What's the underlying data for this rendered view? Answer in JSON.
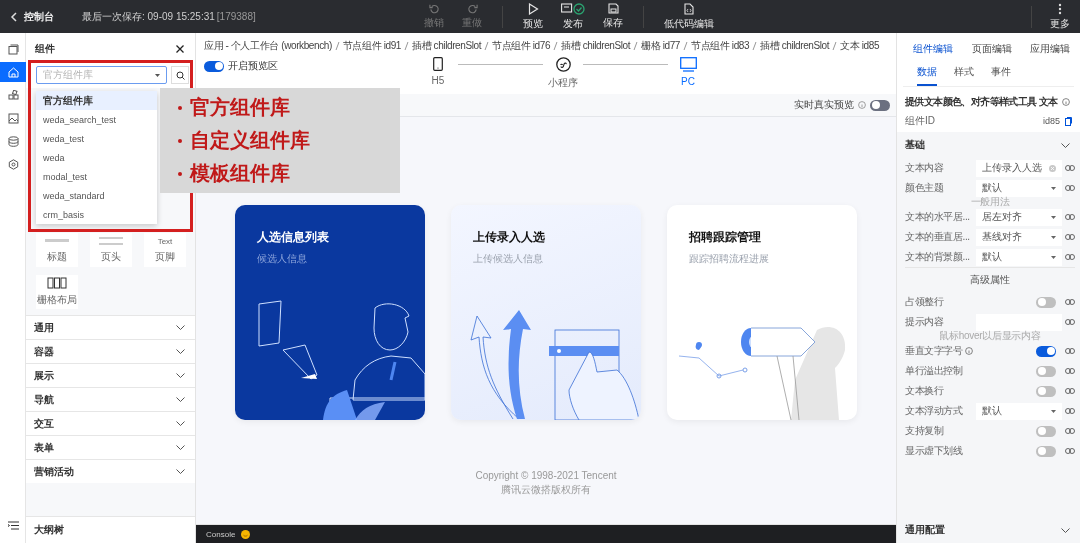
{
  "topbar": {
    "title": "控制台",
    "last_saved": "最后一次保存: 09-09 15:25:31",
    "version": "[179388]",
    "actions": [
      {
        "kind": "undo",
        "label": "撤销",
        "disabled": true
      },
      {
        "kind": "redo",
        "label": "重做",
        "disabled": true
      },
      {
        "kind": "preview",
        "label": "预览",
        "disabled": false
      },
      {
        "kind": "publish",
        "label": "发布",
        "disabled": false
      },
      {
        "kind": "save",
        "label": "保存",
        "disabled": false
      },
      {
        "kind": "code",
        "label": "低代码编辑",
        "disabled": false
      }
    ],
    "more": "更多"
  },
  "rail": [
    {
      "kind": "pages",
      "selected": false
    },
    {
      "kind": "components",
      "selected": true
    },
    {
      "kind": "blocks",
      "selected": false
    },
    {
      "kind": "media",
      "selected": false
    },
    {
      "kind": "data",
      "selected": false
    },
    {
      "kind": "settings",
      "selected": false
    }
  ],
  "component_panel": {
    "title": "组件",
    "library_select": {
      "placeholder": "官方组件库"
    },
    "library_options": [
      {
        "label": "官方组件库",
        "selected": true
      },
      {
        "label": "weda_search_test",
        "selected": false
      },
      {
        "label": "weda_test",
        "selected": false
      },
      {
        "label": "weda",
        "selected": false
      },
      {
        "label": "modal_test",
        "selected": false
      },
      {
        "label": "weda_standard",
        "selected": false
      },
      {
        "label": "crm_basis",
        "selected": false
      }
    ],
    "components": [
      {
        "kind": "title",
        "label": "标题"
      },
      {
        "kind": "header",
        "label": "页头"
      },
      {
        "kind": "footer",
        "label": "页脚",
        "preview": "Text"
      },
      {
        "kind": "grid",
        "label": "栅格布局"
      }
    ],
    "categories": [
      {
        "label": "通用",
        "expanded": false
      },
      {
        "label": "容器",
        "expanded": false
      },
      {
        "label": "展示",
        "expanded": false
      },
      {
        "label": "导航",
        "expanded": false
      },
      {
        "label": "交互",
        "expanded": false
      },
      {
        "label": "表单",
        "expanded": false
      },
      {
        "label": "营销活动",
        "expanded": false
      }
    ],
    "outline": "大纲树"
  },
  "annotation": {
    "items": [
      "官方组件库",
      "自定义组件库",
      "模板组件库"
    ]
  },
  "canvas": {
    "breadcrumb": [
      "应用 - 个人工作台 (workbench)",
      "节点组件 id91",
      "插槽 childrenSlot",
      "节点组件 id76",
      "插槽 childrenSlot",
      "栅格 id77",
      "节点组件 id83",
      "插槽 childrenSlot",
      "文本 id85"
    ],
    "preview_area": {
      "label": "开启预览区",
      "on": true
    },
    "devices": [
      {
        "kind": "phone",
        "label": "H5",
        "selected": false
      },
      {
        "kind": "miniprogram",
        "label": "小程序",
        "selected": false
      },
      {
        "kind": "desktop",
        "label": "PC",
        "selected": true
      }
    ],
    "live_preview": {
      "label": "实时真实预览",
      "on": false
    },
    "cards": [
      {
        "kind": "list",
        "title": "人选信息列表",
        "subtitle": "候选人信息"
      },
      {
        "kind": "upload",
        "title": "上传录入人选",
        "subtitle": "上传候选人信息"
      },
      {
        "kind": "tracking",
        "title": "招聘跟踪管理",
        "subtitle": "跟踪招聘流程进展"
      }
    ],
    "footer": [
      "Copyright © 1998-2021 Tencent",
      "腾讯云微搭版权所有"
    ],
    "console": "Console"
  },
  "right_panel": {
    "tabs": [
      {
        "label": "组件编辑",
        "selected": true
      },
      {
        "label": "页面编辑",
        "selected": false
      },
      {
        "label": "应用编辑",
        "selected": false
      }
    ],
    "subtabs": [
      {
        "label": "数据",
        "selected": true
      },
      {
        "label": "样式",
        "selected": false
      },
      {
        "label": "事件",
        "selected": false
      }
    ],
    "description": "提供文本颜色、对齐等样式工具 文本",
    "component_id": {
      "label": "组件ID",
      "value": "id85"
    },
    "section": {
      "label": "基础",
      "expanded": true
    },
    "properties": [
      {
        "kind": "input",
        "label": "文本内容",
        "value": "上传录入人选"
      },
      {
        "kind": "select",
        "label": "颜色主题",
        "value": "默认",
        "hint": "一般用法"
      },
      {
        "kind": "select",
        "label": "文本的水平居...",
        "value": "居左对齐"
      },
      {
        "kind": "select",
        "label": "文本的垂直居...",
        "value": "基线对齐"
      },
      {
        "kind": "select",
        "label": "文本的背景颜...",
        "value": "默认"
      },
      {
        "kind": "heading",
        "label": "高级属性"
      },
      {
        "kind": "toggle",
        "label": "占领整行",
        "on": false
      },
      {
        "kind": "input",
        "label": "提示内容",
        "hint": "鼠标hover以后显示内容"
      },
      {
        "kind": "toggle",
        "label": "垂直文字字号",
        "on": true,
        "info": true
      },
      {
        "kind": "toggle",
        "label": "单行溢出控制",
        "on": false
      },
      {
        "kind": "toggle",
        "label": "文本换行",
        "on": false
      },
      {
        "kind": "select",
        "label": "文本浮动方式",
        "value": "默认"
      },
      {
        "kind": "toggle",
        "label": "支持复制",
        "on": false
      },
      {
        "kind": "toggle",
        "label": "显示虚下划线",
        "on": false
      }
    ],
    "bottom_section": {
      "label": "通用配置",
      "expanded": false
    }
  }
}
